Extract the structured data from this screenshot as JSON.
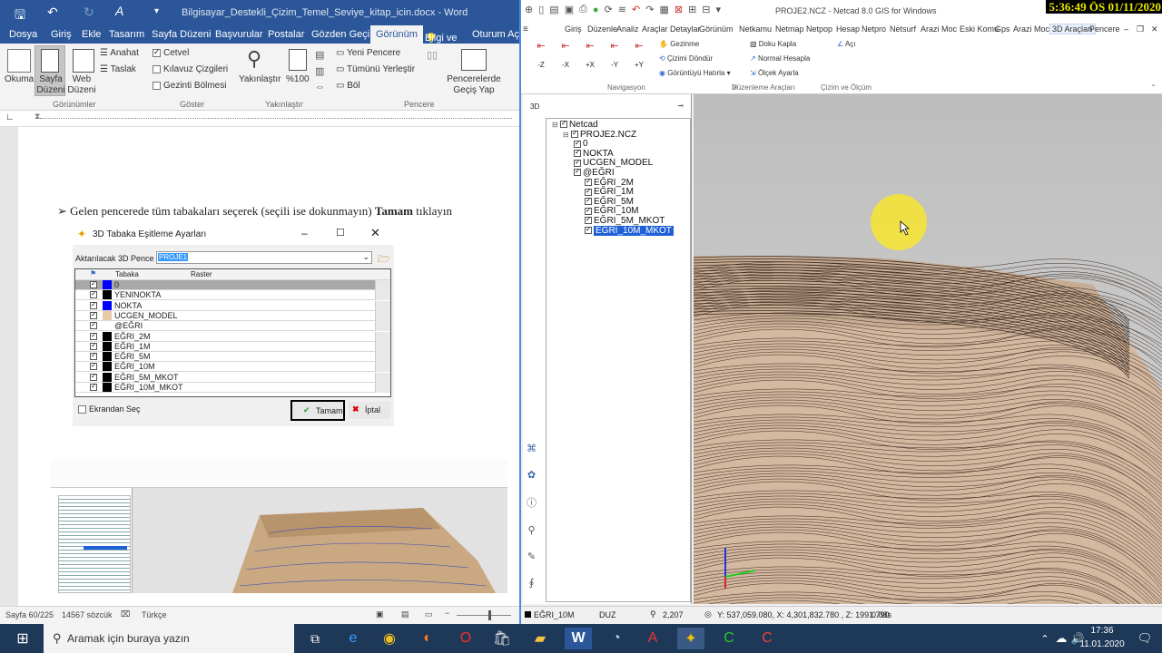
{
  "word": {
    "quick_access": [
      "save-icon",
      "undo-icon",
      "redo-icon",
      "format-icon",
      "customize-icon"
    ],
    "title": "Bilgisayar_Destekli_Çizim_Temel_Seviye_kitap_icin.docx  -  Word",
    "tabs": [
      "Dosya",
      "Giriş",
      "Ekle",
      "Tasarım",
      "Sayfa Düzeni",
      "Başvurular",
      "Postalar",
      "Gözden Geçir",
      "Görünüm",
      "Bilgi ve",
      "Oturum Aç"
    ],
    "active_tab": "Görünüm",
    "ribbon": {
      "okuma_modu": "Okuma Modu",
      "sayfa_duzeni": "Sayfa Düzeni",
      "web_duzeni": "Web Düzeni",
      "anahat": "Anahat",
      "taslak": "Taslak",
      "cetvel": "Cetvel",
      "kilavuz": "Kılavuz Çizgileri",
      "gezinti": "Gezinti Bölmesi",
      "yakinlastir": "Yakınlaştır",
      "yuzde": "%100",
      "yeni_pencere": "Yeni Pencere",
      "tumunu_yerlestir": "Tümünü Yerleştir",
      "bol": "Böl",
      "pencerelerde_gecis": "Pencerelerde Geçiş Yap",
      "groups": [
        "Görünümler",
        "Göster",
        "Yakınlaştır",
        "Pencere"
      ]
    },
    "doc_text_normal": "Gelen pencerede tüm tabakaları seçerek (seçili ise dokunmayın)",
    "doc_text_bold": "Tamam",
    "doc_text_end": "tıklayın",
    "status": {
      "page": "Sayfa 60/225",
      "words": "14567 sözcük",
      "lang": "Türkçe"
    }
  },
  "dialog": {
    "title": "3D Tabaka Eşitleme Ayarları",
    "aktarilacak_label": "Aktarılacak 3D Pence",
    "aktarilacak_value": "PROJE1",
    "col_tabaka": "Tabaka",
    "col_raster": "Raster",
    "rows": [
      {
        "name": "0",
        "color": "#0000ff",
        "selected": true
      },
      {
        "name": "YENINOKTA",
        "color": "#000000",
        "selected": false
      },
      {
        "name": "NOKTA",
        "color": "#0000ff",
        "selected": false
      },
      {
        "name": "UCGEN_MODEL",
        "color": "#e8c9a8",
        "selected": false
      },
      {
        "name": "@EĞRI",
        "color": "#ffffff",
        "selected": false
      },
      {
        "name": "EĞRI_2M",
        "color": "#000000",
        "selected": false
      },
      {
        "name": "EĞRI_1M",
        "color": "#000000",
        "selected": false
      },
      {
        "name": "EĞRI_5M",
        "color": "#000000",
        "selected": false
      },
      {
        "name": "EĞRI_10M",
        "color": "#000000",
        "selected": false
      },
      {
        "name": "EĞRI_5M_MKOT",
        "color": "#000000",
        "selected": false
      },
      {
        "name": "EĞRI_10M_MKOT",
        "color": "#000000",
        "selected": false
      }
    ],
    "ekrandan_sec": "Ekrandan Seç",
    "tamam": "Tamam",
    "iptal": "İptal"
  },
  "netcad": {
    "title": "PROJE2.NCZ - Netcad 8.0 GIS for Windows",
    "clock": "5:36:49 ÖS 01/11/2020",
    "tabs": [
      "Giriş",
      "Düzenle",
      "Analiz",
      "Araçlar",
      "Detaylar",
      "Görünüm",
      "Netkamu",
      "Netmap",
      "Netpop",
      "Hesap",
      "Netpro",
      "Netsurf",
      "Arazi Moc",
      "Eski Komu",
      "Gps",
      "Arazi Moc",
      "3D Araçları",
      "Pencere"
    ],
    "active_tab": "3D Araçları",
    "nav_buttons": [
      "-Z",
      "-X",
      "+X",
      "-Y",
      "+Y"
    ],
    "ribbon": {
      "gezinme": "Gezinme",
      "cizimi_dondur": "Çizimi Döndür",
      "goruntuyu_hatirla": "Görüntüyü Hatırla",
      "doku_kapla": "Doku Kapla",
      "normal_hesapla": "Normal Hesapla",
      "olcek_ayarla": "Ölçek Ayarla",
      "aci": "Açı",
      "groups": [
        "Navigasyon",
        "Düzenleme Araçları",
        "Çizim ve Ölçüm"
      ]
    },
    "panel_title": "3D",
    "tree": [
      {
        "label": "Netcad",
        "indent": 0
      },
      {
        "label": "PROJE2.NCZ",
        "indent": 1
      },
      {
        "label": "0",
        "indent": 2
      },
      {
        "label": "NOKTA",
        "indent": 2
      },
      {
        "label": "UCGEN_MODEL",
        "indent": 2
      },
      {
        "label": "@EĞRI",
        "indent": 2
      },
      {
        "label": "EĞRI_2M",
        "indent": 3
      },
      {
        "label": "EĞRI_1M",
        "indent": 3
      },
      {
        "label": "EĞRI_5M",
        "indent": 3
      },
      {
        "label": "EĞRI_10M",
        "indent": 3
      },
      {
        "label": "EĞRI_5M_MKOT",
        "indent": 3
      },
      {
        "label": "EĞRI_10M_MKOT",
        "indent": 3,
        "selected": true
      }
    ],
    "status": {
      "layer": "EĞRI_10M",
      "mode": "DUZ",
      "zoom": "2,207",
      "coords": "Y: 537,059.080, X: 4,301,832.780 , Z: 1991.790",
      "time": "0.08s"
    }
  },
  "taskbar": {
    "search_placeholder": "Aramak için buraya yazın",
    "time": "17:36",
    "date": "11.01.2020"
  }
}
